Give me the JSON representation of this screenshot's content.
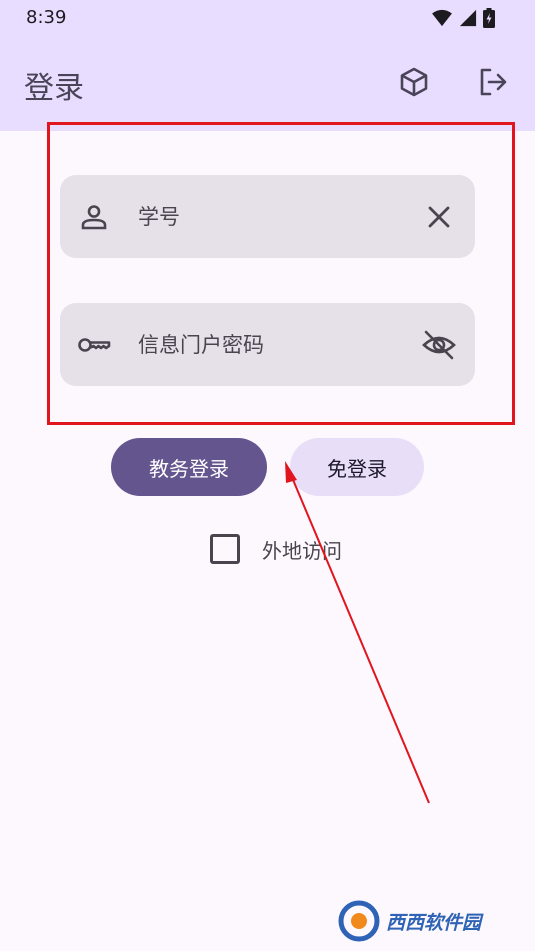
{
  "status_bar": {
    "time": "8:39"
  },
  "app_bar": {
    "title": "登录"
  },
  "form": {
    "student_id_placeholder": "学号",
    "password_placeholder": "信息门户密码"
  },
  "buttons": {
    "primary_label": "教务登录",
    "secondary_label": "免登录"
  },
  "remote_access": {
    "label": "外地访问",
    "checked": false
  },
  "colors": {
    "app_bar_bg": "#e9ddff",
    "primary": "#65558f",
    "tonal": "#e8def8",
    "field_bg": "#e6e0e9",
    "annotation_red": "#e0151e"
  },
  "icons": {
    "status": [
      "wifi-icon",
      "signal-icon",
      "battery-charging-icon"
    ],
    "app_bar": [
      "cube-icon",
      "logout-icon"
    ],
    "fields": [
      "person-icon",
      "clear-icon",
      "key-icon",
      "visibility-off-icon"
    ]
  }
}
